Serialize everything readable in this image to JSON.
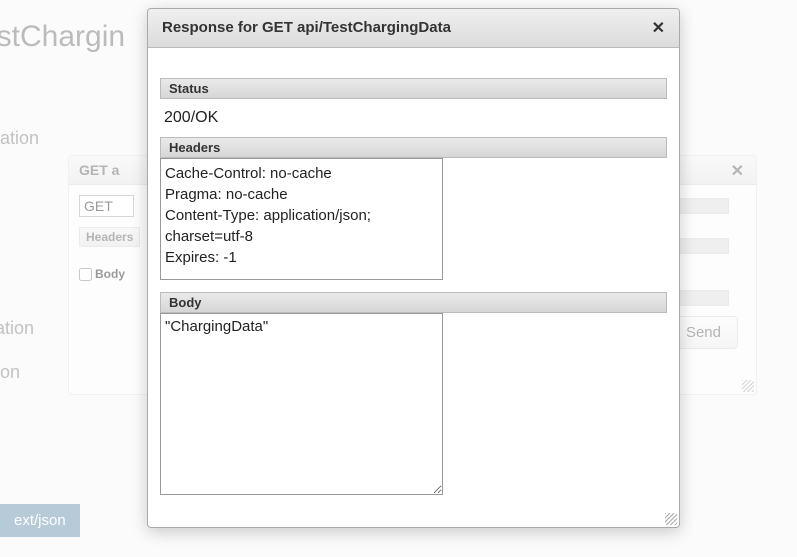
{
  "background": {
    "page_title": "estChargin",
    "label_ation": "ation",
    "label_mation": "mation",
    "label_on": "on",
    "badge_text": "ext/json",
    "panel": {
      "header_prefix": "GET a",
      "method_value": "GET",
      "headers_label": "Headers",
      "body_checkbox_label": "Body",
      "send_button": "Send"
    }
  },
  "modal": {
    "title": "Response for GET api/TestChargingData",
    "sections": {
      "status_label": "Status",
      "status_value": "200/OK",
      "headers_label": "Headers",
      "headers_content": "Cache-Control: no-cache\nPragma: no-cache\nContent-Type: application/json; charset=utf-8\nExpires: -1",
      "body_label": "Body",
      "body_content": "\"ChargingData\""
    }
  }
}
